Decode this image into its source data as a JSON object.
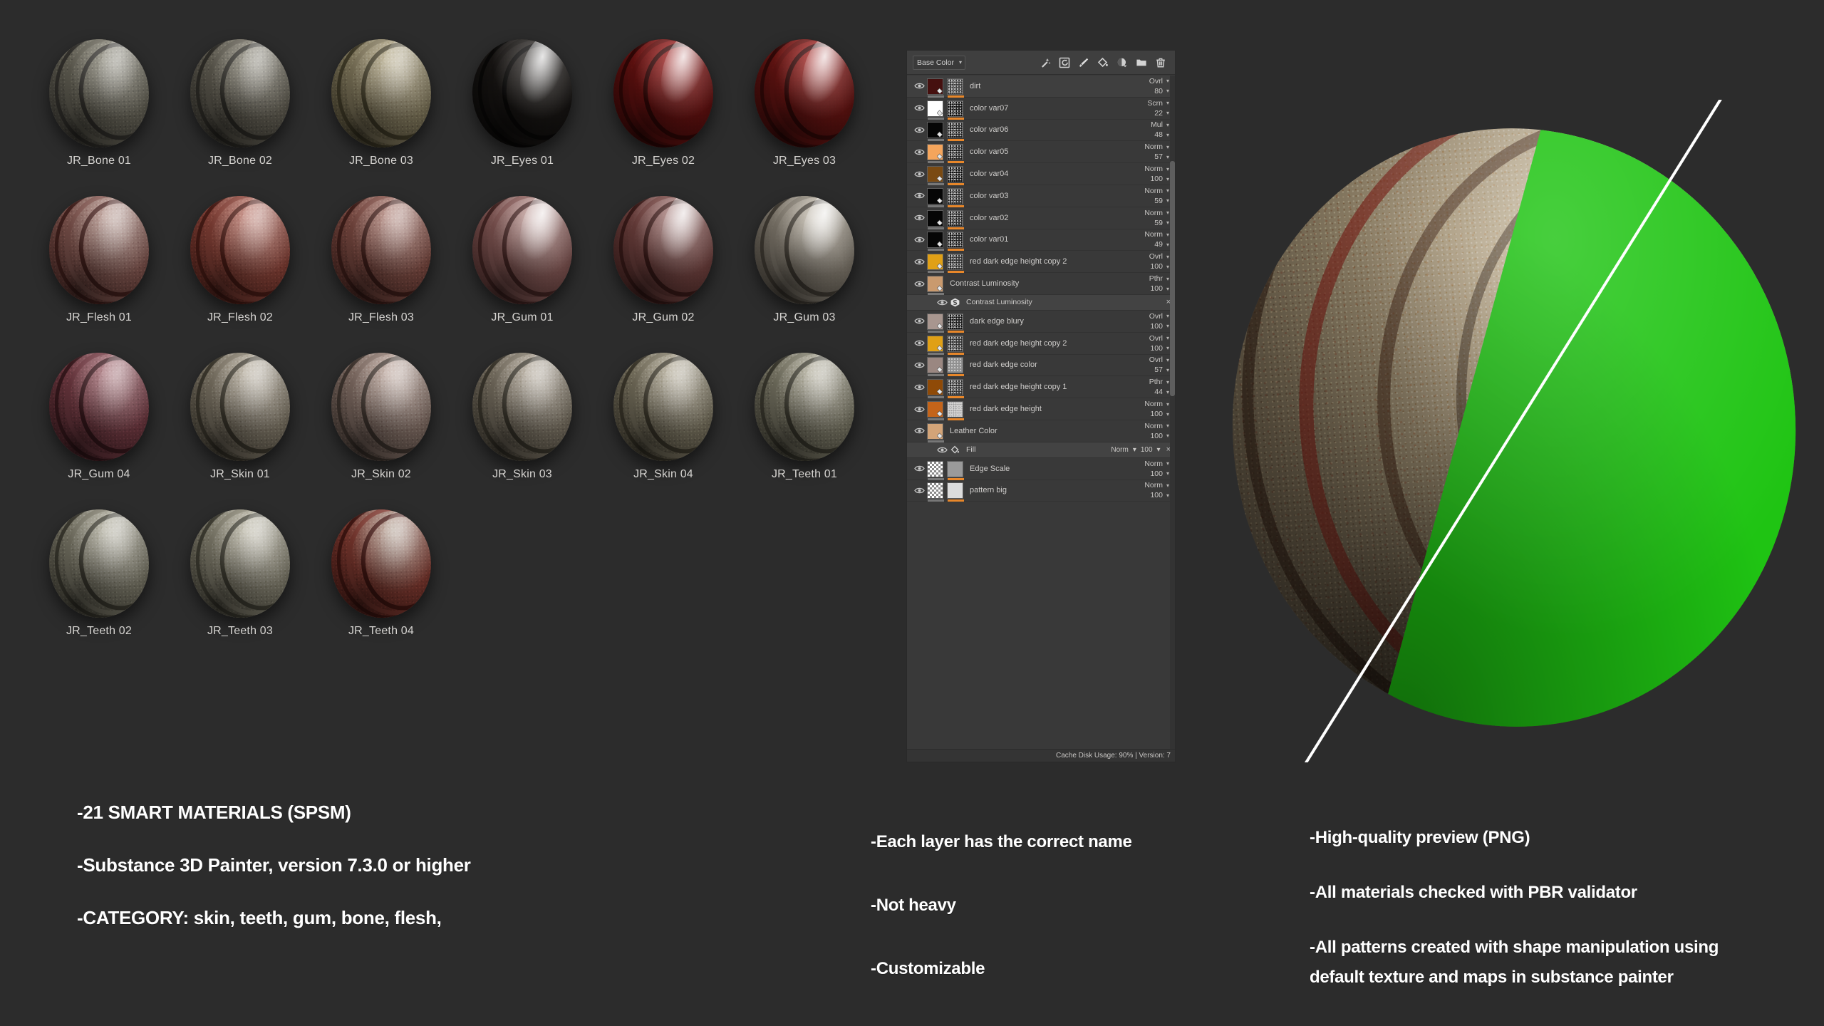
{
  "background_color": "#2c2c2c",
  "materials": {
    "rows": [
      [
        {
          "label": "JR_Bone 01",
          "base": "#8d8a7c",
          "mid": "#6f6c5f",
          "dark": "#3b3934",
          "rough": true
        },
        {
          "label": "JR_Bone 02",
          "base": "#8b8779",
          "mid": "#6a665a",
          "dark": "#37352f",
          "rough": true
        },
        {
          "label": "JR_Bone 03",
          "base": "#b8ad8c",
          "mid": "#8d8365",
          "dark": "#4b452f",
          "rough": true
        },
        {
          "label": "JR_Eyes 01",
          "base": "#2e2a27",
          "mid": "#1a1715",
          "dark": "#0b0a09",
          "rough": false
        },
        {
          "label": "JR_Eyes 02",
          "base": "#a02220",
          "mid": "#6d1312",
          "dark": "#380807",
          "rough": false
        },
        {
          "label": "JR_Eyes 03",
          "base": "#a52522",
          "mid": "#6f1614",
          "dark": "#3a0a09",
          "rough": false
        }
      ],
      [
        {
          "label": "JR_Flesh 01",
          "base": "#b89a91",
          "mid": "#8c5d56",
          "dark": "#4d2622",
          "rough": true
        },
        {
          "label": "JR_Flesh 02",
          "base": "#c08074",
          "mid": "#93483d",
          "dark": "#55211a",
          "rough": true
        },
        {
          "label": "JR_Flesh 03",
          "base": "#b2867c",
          "mid": "#885249",
          "dark": "#4a241f",
          "rough": true
        },
        {
          "label": "JR_Gum 01",
          "base": "#c2a09c",
          "mid": "#8f5f5c",
          "dark": "#4e2b29",
          "rough": false
        },
        {
          "label": "JR_Gum 02",
          "base": "#a9827f",
          "mid": "#7b4845",
          "dark": "#431f1d",
          "rough": false
        },
        {
          "label": "JR_Gum 03",
          "base": "#c4bcae",
          "mid": "#8f877a",
          "dark": "#4c463d",
          "rough": false
        }
      ],
      [
        {
          "label": "JR_Gum 04",
          "base": "#a9737a",
          "mid": "#7c4049",
          "dark": "#411d22",
          "rough": true
        },
        {
          "label": "JR_Skin 01",
          "base": "#b9b0a0",
          "mid": "#8a8170",
          "dark": "#474236",
          "rough": true
        },
        {
          "label": "JR_Skin 02",
          "base": "#c0aaa0",
          "mid": "#907a70",
          "dark": "#4b3f38",
          "rough": true
        },
        {
          "label": "JR_Skin 03",
          "base": "#b4aa9b",
          "mid": "#857c6c",
          "dark": "#454035",
          "rough": true
        },
        {
          "label": "JR_Skin 04",
          "base": "#b3ab97",
          "mid": "#857e69",
          "dark": "#464133",
          "rough": true
        },
        {
          "label": "JR_Teeth 01",
          "base": "#b4b09e",
          "mid": "#85826f",
          "dark": "#454337",
          "rough": true
        }
      ],
      [
        {
          "label": "JR_Teeth 02",
          "base": "#b5b2a2",
          "mid": "#868372",
          "dark": "#454338",
          "rough": true
        },
        {
          "label": "JR_Teeth 03",
          "base": "#c0bcab",
          "mid": "#8f8b79",
          "dark": "#4a483c",
          "rough": true
        },
        {
          "label": "JR_Teeth 04",
          "base": "#b8a89a",
          "mid": "#8a3f35",
          "dark": "#4a1a15",
          "rough": true
        }
      ]
    ]
  },
  "layer_panel": {
    "channel_selector": {
      "value": "Base Color",
      "caret": "chevron-down-icon"
    },
    "toolbar_icons": [
      "magic-wand-icon",
      "smart-mask-icon",
      "paint-brush-icon",
      "paint-bucket-icon",
      "fill-sphere-icon",
      "folder-icon",
      "trash-icon"
    ],
    "status_text": "Cache Disk Usage:   90%  | Version: 7",
    "layers": [
      {
        "name": "dirt",
        "blend": "Ovrl",
        "opacity": "80",
        "color": "#45100f",
        "mask": "#3a3a3a",
        "mask_kind": "noise",
        "active": true,
        "selected": true
      },
      {
        "name": "color var07",
        "blend": "Scrn",
        "opacity": "22",
        "color": "#ffffff",
        "mask": "#0d0d0d",
        "mask_kind": "noise"
      },
      {
        "name": "color var06",
        "blend": "Mul",
        "opacity": "48",
        "color": "#060606",
        "mask": "#1c1c1c",
        "mask_kind": "noise"
      },
      {
        "name": "color var05",
        "blend": "Norm",
        "opacity": "57",
        "color": "#f5a55c",
        "mask": "#1a1a1a",
        "mask_kind": "noise"
      },
      {
        "name": "color var04",
        "blend": "Norm",
        "opacity": "100",
        "color": "#7a4a12",
        "mask": "#0f0f0f",
        "mask_kind": "noise"
      },
      {
        "name": "color var03",
        "blend": "Norm",
        "opacity": "59",
        "color": "#060606",
        "mask": "#222222",
        "mask_kind": "noise"
      },
      {
        "name": "color var02",
        "blend": "Norm",
        "opacity": "59",
        "color": "#060606",
        "mask": "#1d1d1d",
        "mask_kind": "noise"
      },
      {
        "name": "color var01",
        "blend": "Norm",
        "opacity": "49",
        "color": "#060606",
        "mask": "#151515",
        "mask_kind": "noise"
      },
      {
        "name": "red dark edge height copy 2",
        "blend": "Ovrl",
        "opacity": "100",
        "color": "#e0a016",
        "mask": "#2a2a2a",
        "mask_kind": "noise"
      },
      {
        "name": "Contrast Luminosity",
        "blend": "Pthr",
        "opacity": "100",
        "color": "#c99a6e",
        "mask": null,
        "mask_kind": null,
        "effect": {
          "name": "Contrast Luminosity",
          "icon": "substance-effect-icon",
          "close": "×"
        }
      },
      {
        "name": "dark edge blury",
        "blend": "Ovrl",
        "opacity": "100",
        "color": "#a8968f",
        "mask": "#111111",
        "mask_kind": "noise",
        "active": true
      },
      {
        "name": "red dark edge height copy 2",
        "blend": "Ovrl",
        "opacity": "100",
        "color": "#e0a016",
        "mask": "#2d2d2d",
        "mask_kind": "noise"
      },
      {
        "name": "red dark edge color",
        "blend": "Ovrl",
        "opacity": "57",
        "color": "#9a8781",
        "mask": "#8e8e8e",
        "mask_kind": "noise"
      },
      {
        "name": "red dark edge height copy 1",
        "blend": "Pthr",
        "opacity": "44",
        "color": "#8f4a07",
        "mask": "#2c2c2c",
        "mask_kind": "noise"
      },
      {
        "name": "red dark edge height",
        "blend": "Norm",
        "opacity": "100",
        "color": "#c4641a",
        "mask": "#d0cfcd",
        "mask_kind": "noise"
      },
      {
        "name": "Leather Color",
        "blend": "Norm",
        "opacity": "100",
        "color": "#d3a478",
        "mask": null,
        "mask_kind": null,
        "effect": {
          "name": "Fill",
          "icon": "paint-bucket-icon",
          "blend": "Norm",
          "opacity": "100",
          "close": "×"
        }
      },
      {
        "name": "Edge Scale",
        "blend": "Norm",
        "opacity": "100",
        "color": "checker",
        "mask": "#9a9a9a",
        "mask_kind": "flat"
      },
      {
        "name": "pattern big",
        "blend": "Norm",
        "opacity": "100",
        "color": "checker",
        "mask": "#dcdcdc",
        "mask_kind": "flat"
      }
    ]
  },
  "preview": {
    "split_line_color": "#ffffff",
    "green_color": "#1fc413",
    "material_description": "organic bone-flesh smart material ball"
  },
  "bullets": {
    "left": [
      "-21 SMART MATERIALS (SPSM)",
      "-Substance 3D Painter, version 7.3.0 or higher",
      "-CATEGORY: skin, teeth, gum, bone, flesh,"
    ],
    "middle": [
      "-Each layer has the correct name",
      "-Not heavy",
      "-Customizable"
    ],
    "right": [
      "-High-quality preview (PNG)",
      "-All materials checked with PBR validator",
      "-All patterns created with shape manipulation using",
      "default texture and maps in substance painter"
    ]
  }
}
